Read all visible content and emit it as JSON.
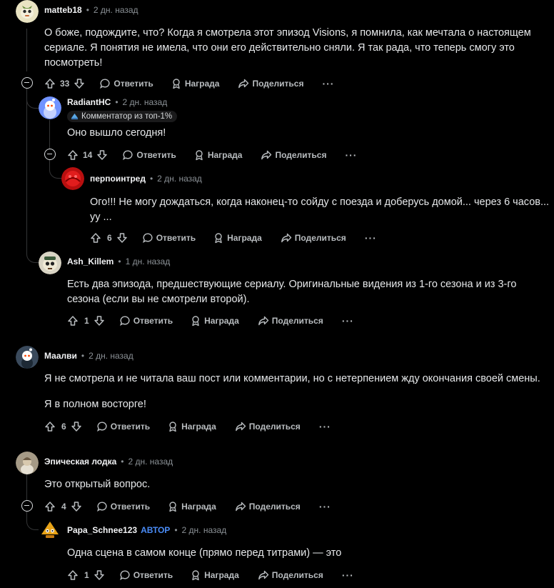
{
  "comments": [
    {
      "user": "matteb18",
      "time": "2 дн. назад",
      "body": "О боже, подождите, что? Когда я смотрела этот эпизод Visions, я помнила, как мечтала о настоящем сериале. Я понятия не имела, что они его действительно сняли. Я так рада, что теперь смогу это посмотреть!",
      "votes": "33"
    },
    {
      "user": "RadiantHC",
      "time": "2 дн. назад",
      "flair": "Комментатор из топ-1%",
      "body": "Оно вышло сегодня!",
      "votes": "14"
    },
    {
      "user": "перпоинтред",
      "time": "2 дн. назад",
      "body_line1": "Ого!!! Не могу дождаться, когда наконец-то сойду с поезда и доберусь домой... через 6 часов...",
      "body_line2": "уу ...",
      "votes": "6"
    },
    {
      "user": "Ash_Killem",
      "time": "1 дн. назад",
      "body": "Есть два эпизода, предшествующие сериалу. Оригинальные видения из 1-го сезона и из 3-го сезона (если вы не смотрели второй).",
      "votes": "1"
    },
    {
      "user": "Маалви",
      "time": "2 дн. назад",
      "body_p1": "Я не смотрела и не читала ваш пост или комментарии, но с нетерпением жду окончания своей смены.",
      "body_p2": "Я в полном восторге!",
      "votes": "6"
    },
    {
      "user": "Эпическая лодка",
      "time": "2 дн. назад",
      "body": "Это открытый вопрос.",
      "votes": "4"
    },
    {
      "user": "Papa_Schnee123",
      "op_badge": "АВТОР",
      "time": "2 дн. назад",
      "body": "Одна сцена в самом конце (прямо перед титрами) — это",
      "votes": "1"
    }
  ],
  "labels": {
    "separator": "•",
    "reply": "Ответить",
    "award": "Награда",
    "share": "Поделиться",
    "more": "···"
  },
  "colors": {
    "background": "#000000",
    "text": "#e6e8ea",
    "muted": "#8b9196",
    "op_badge": "#4a8cf7",
    "thread_line": "#343536"
  }
}
